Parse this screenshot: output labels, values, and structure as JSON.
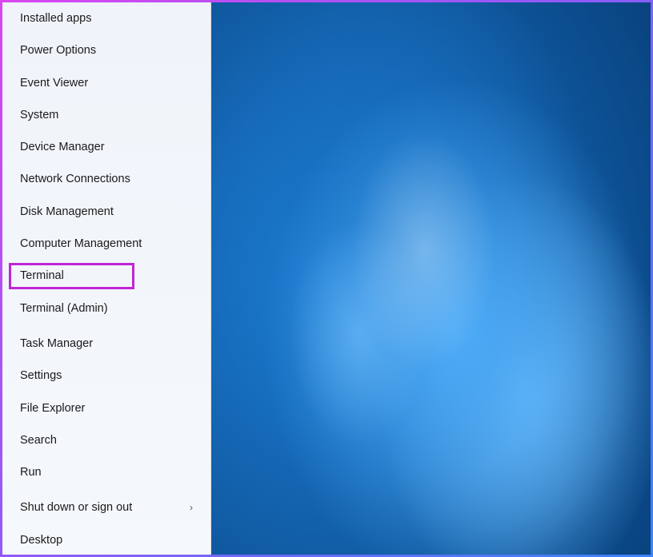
{
  "menu": {
    "group1": [
      {
        "id": "installed-apps",
        "label": "Installed apps"
      },
      {
        "id": "power-options",
        "label": "Power Options"
      },
      {
        "id": "event-viewer",
        "label": "Event Viewer"
      },
      {
        "id": "system",
        "label": "System"
      },
      {
        "id": "device-manager",
        "label": "Device Manager"
      },
      {
        "id": "network-connections",
        "label": "Network Connections"
      },
      {
        "id": "disk-management",
        "label": "Disk Management"
      },
      {
        "id": "computer-management",
        "label": "Computer Management"
      },
      {
        "id": "terminal",
        "label": "Terminal"
      },
      {
        "id": "terminal-admin",
        "label": "Terminal (Admin)"
      }
    ],
    "group2": [
      {
        "id": "task-manager",
        "label": "Task Manager"
      },
      {
        "id": "settings",
        "label": "Settings"
      },
      {
        "id": "file-explorer",
        "label": "File Explorer"
      },
      {
        "id": "search",
        "label": "Search"
      },
      {
        "id": "run",
        "label": "Run"
      }
    ],
    "group3": [
      {
        "id": "shut-down",
        "label": "Shut down or sign out",
        "hasSubmenu": true
      },
      {
        "id": "desktop",
        "label": "Desktop"
      }
    ]
  },
  "highlight": {
    "itemId": "terminal"
  }
}
